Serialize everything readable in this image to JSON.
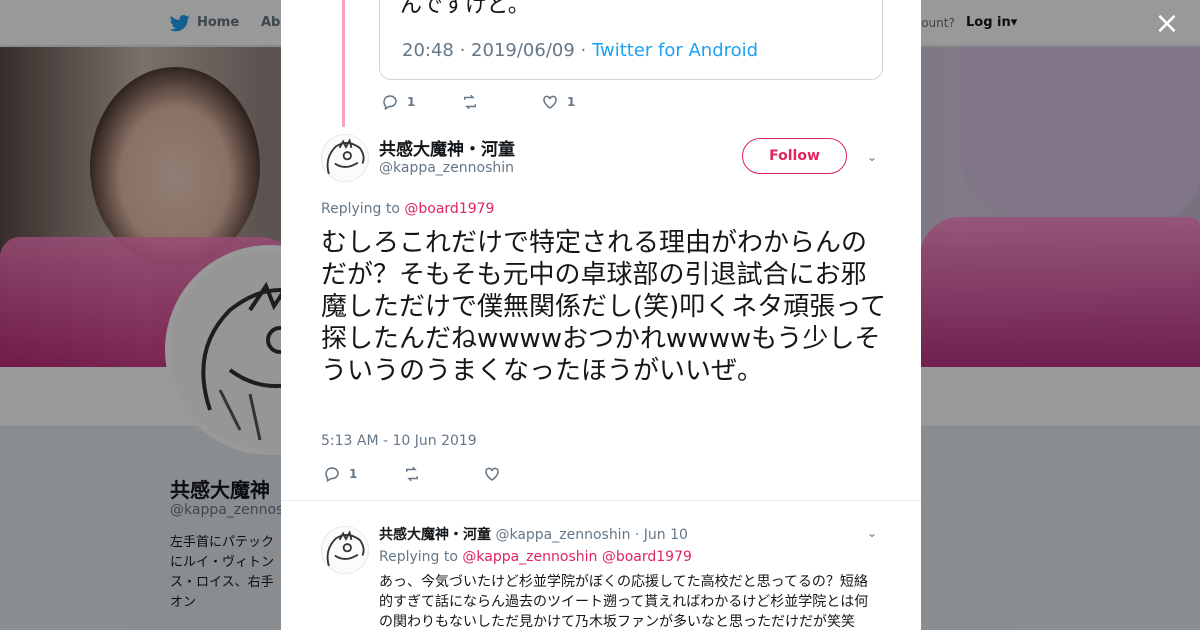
{
  "background_page": {
    "nav": {
      "home_label": "Home",
      "about_label": "Abo",
      "account_prompt": "ccount?",
      "login_label": "Log in"
    },
    "profile": {
      "name": "共感大魔神",
      "handle": "@kappa_zennoshin",
      "bio": "左手首にパテックにルイ・ヴィトンス・ロイス、右手オン"
    }
  },
  "modal": {
    "close_label": "×",
    "parent_tweet": {
      "partial_text": "んですけど。",
      "quoted_meta": "20:48 · 2019/06/09 · ",
      "quoted_client": "Twitter for Android",
      "reply_count": "1",
      "like_count": "1"
    },
    "main_tweet": {
      "author_name": "共感大魔神・河童",
      "author_handle": "@kappa_zennoshin",
      "follow_label": "Follow",
      "replying_prefix": "Replying to ",
      "replying_to": "@board1979",
      "text": "むしろこれだけで特定される理由がわからんのだが？そもそも元中の卓球部の引退試合にお邪魔しただけで僕無関係だし(笑)叩くネタ頑張って探したんだねwwwwおつかれwwwwもう少しそういうのうまくなったほうがいいぜ。",
      "timestamp": "5:13 AM - 10 Jun 2019",
      "reply_count": "1"
    },
    "reply_tweet": {
      "author_name": "共感大魔神・河童",
      "author_handle": "@kappa_zennoshin",
      "date": "· Jun 10",
      "replying_prefix": "Replying to ",
      "replying_to_1": "@kappa_zennoshin",
      "replying_to_2": "@board1979",
      "text": "あっ、今気づいたけど杉並学院がぼくの応援してた高校だと思ってるの？短絡的すぎて話にならん過去のツイート遡って貰えればわかるけど杉並学院とは何の関わりもないしただ見かけて乃木坂ファンが多いなと思っただけだが笑笑"
    },
    "colors": {
      "accent": "#e0245e",
      "twitter_blue": "#1da1f2",
      "muted": "#657786"
    }
  }
}
